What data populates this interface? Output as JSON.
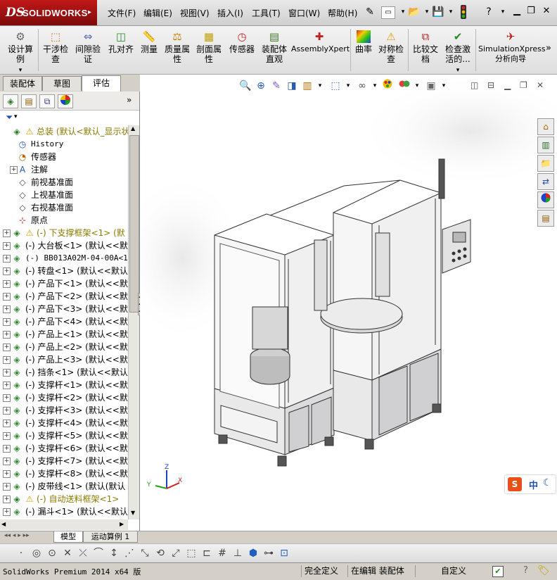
{
  "app": {
    "logo_ds": "DS",
    "logo_name": "SOLIDWORKS"
  },
  "menu": [
    "文件(F)",
    "编辑(E)",
    "视图(V)",
    "插入(I)",
    "工具(T)",
    "窗口(W)",
    "帮助(H)"
  ],
  "quick_access": {
    "new_icon": "new-document-icon",
    "open_icon": "open-folder-icon",
    "save_icon": "save-icon",
    "options_icon": "traffic-light-icon",
    "help": "?"
  },
  "ribbon": [
    {
      "label": "设计算\n例",
      "icon": "design-study-icon"
    },
    {
      "label": "干涉检\n查",
      "icon": "interference-check-icon"
    },
    {
      "label": "间隙验\n证",
      "icon": "clearance-verification-icon"
    },
    {
      "label": "孔对齐",
      "icon": "hole-alignment-icon"
    },
    {
      "label": "测量",
      "icon": "measure-icon"
    },
    {
      "label": "质量属\n性",
      "icon": "mass-properties-icon"
    },
    {
      "label": "剖面属\n性",
      "icon": "section-properties-icon"
    },
    {
      "label": "传感器",
      "icon": "sensor-icon"
    },
    {
      "label": "装配体\n直观",
      "icon": "assembly-visualization-icon"
    },
    {
      "label": "AssemblyXpert",
      "icon": "assemblyxpert-icon"
    },
    {
      "label": "曲率",
      "icon": "curvature-icon"
    },
    {
      "label": "对称检\n查",
      "icon": "symmetry-check-icon"
    },
    {
      "label": "比较文\n档",
      "icon": "compare-documents-icon"
    },
    {
      "label": "检查激\n活的...",
      "icon": "check-active-icon"
    },
    {
      "label": "SimulationXpress\n分析向导",
      "icon": "simulationxpress-icon"
    }
  ],
  "command_tabs": [
    {
      "label": "装配体",
      "active": false
    },
    {
      "label": "草图",
      "active": false
    },
    {
      "label": "评估",
      "active": true
    }
  ],
  "tree": [
    {
      "level": 0,
      "expand": "",
      "icon": "assembly-root-icon",
      "warn": true,
      "text": "总装  (默认<默认_显示状",
      "yellow": true
    },
    {
      "level": 1,
      "expand": "",
      "icon": "history-icon",
      "text": "History",
      "mono": true
    },
    {
      "level": 1,
      "expand": "",
      "icon": "sensor-icon",
      "text": "传感器"
    },
    {
      "level": 1,
      "expand": "+",
      "icon": "annotation-icon",
      "text": "注解"
    },
    {
      "level": 1,
      "expand": "",
      "icon": "plane-icon",
      "text": "前视基准面"
    },
    {
      "level": 1,
      "expand": "",
      "icon": "plane-icon",
      "text": "上视基准面"
    },
    {
      "level": 1,
      "expand": "",
      "icon": "plane-icon",
      "text": "右视基准面"
    },
    {
      "level": 1,
      "expand": "",
      "icon": "origin-icon",
      "text": "原点"
    },
    {
      "level": 0,
      "expand": "+",
      "icon": "subassembly-icon",
      "warn": true,
      "text": "(-) 下支撑框架<1> (默",
      "yellow": true
    },
    {
      "level": 0,
      "expand": "+",
      "icon": "part-icon",
      "text": "(-) 大台板<1> (默认<<默"
    },
    {
      "level": 0,
      "expand": "+",
      "icon": "part-icon",
      "text": "(-) BB013A02M-04-00A<1>",
      "mono": true
    },
    {
      "level": 0,
      "expand": "+",
      "icon": "part-icon",
      "text": "(-) 转盘<1> (默认<<默认"
    },
    {
      "level": 0,
      "expand": "+",
      "icon": "part-icon",
      "text": "(-) 产品下<1> (默认<<默"
    },
    {
      "level": 0,
      "expand": "+",
      "icon": "part-icon",
      "text": "(-) 产品下<2> (默认<<默"
    },
    {
      "level": 0,
      "expand": "+",
      "icon": "part-icon",
      "text": "(-) 产品下<3> (默认<<默"
    },
    {
      "level": 0,
      "expand": "+",
      "icon": "part-icon",
      "text": "(-) 产品下<4> (默认<<默"
    },
    {
      "level": 0,
      "expand": "+",
      "icon": "part-icon",
      "text": "(-) 产品上<1> (默认<<默"
    },
    {
      "level": 0,
      "expand": "+",
      "icon": "part-icon",
      "text": "(-) 产品上<2> (默认<<默"
    },
    {
      "level": 0,
      "expand": "+",
      "icon": "part-icon",
      "text": "(-) 产品上<3> (默认<<默"
    },
    {
      "level": 0,
      "expand": "+",
      "icon": "part-icon",
      "text": "(-) 挡条<1> (默认<<默认"
    },
    {
      "level": 0,
      "expand": "+",
      "icon": "part-icon",
      "text": "(-) 支撑杆<1> (默认<<默"
    },
    {
      "level": 0,
      "expand": "+",
      "icon": "part-icon",
      "text": "(-) 支撑杆<2> (默认<<默"
    },
    {
      "level": 0,
      "expand": "+",
      "icon": "part-icon",
      "text": "(-) 支撑杆<3> (默认<<默"
    },
    {
      "level": 0,
      "expand": "+",
      "icon": "part-icon",
      "text": "(-) 支撑杆<4> (默认<<默"
    },
    {
      "level": 0,
      "expand": "+",
      "icon": "part-icon",
      "text": "(-) 支撑杆<5> (默认<<默"
    },
    {
      "level": 0,
      "expand": "+",
      "icon": "part-icon",
      "text": "(-) 支撑杆<6> (默认<<默"
    },
    {
      "level": 0,
      "expand": "+",
      "icon": "part-icon",
      "text": "(-) 支撑杆<7> (默认<<默"
    },
    {
      "level": 0,
      "expand": "+",
      "icon": "part-icon",
      "text": "(-) 支撑杆<8> (默认<<默"
    },
    {
      "level": 0,
      "expand": "+",
      "icon": "part-icon",
      "text": "(-) 皮带线<1> (默认(默认"
    },
    {
      "level": 0,
      "expand": "+",
      "icon": "subassembly-icon",
      "warn": true,
      "text": "(-) 自动送料框架<1>",
      "yellow": true
    },
    {
      "level": 0,
      "expand": "+",
      "icon": "part-icon",
      "text": "(-) 漏斗<1> (默认<<默认"
    }
  ],
  "bottom_tabs": [
    {
      "label": "模型",
      "active": true
    },
    {
      "label": "运动算例 1",
      "active": false
    }
  ],
  "status": {
    "version": "SolidWorks Premium 2014 x64 版",
    "definition": "完全定义",
    "editing": "在编辑 装配体",
    "custom": "自定义"
  },
  "ime": {
    "logo": "S",
    "mode": "中"
  },
  "axes": {
    "x": "X",
    "y": "Y",
    "z": "Z"
  },
  "colors": {
    "logo_red": "#b01515",
    "warning_yellow": "#e8c800",
    "selection_yellow": "#8a7a00"
  }
}
